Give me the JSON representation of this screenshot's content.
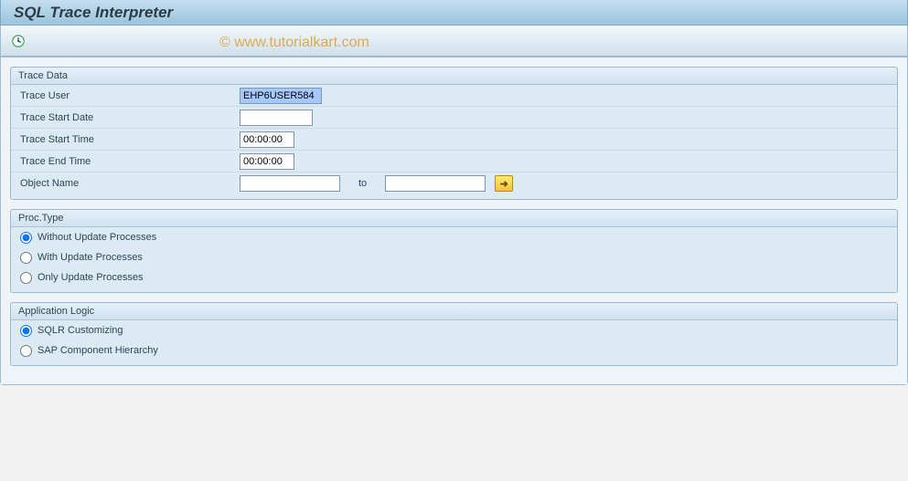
{
  "title": "SQL Trace Interpreter",
  "watermark": "© www.tutorialkart.com",
  "trace": {
    "legend": "Trace Data",
    "user_label": "Trace User",
    "user_value": "EHP6USER584",
    "start_date_label": "Trace Start Date",
    "start_date_value": "",
    "start_time_label": "Trace Start Time",
    "start_time_value": "00:00:00",
    "end_time_label": "Trace End Time",
    "end_time_value": "00:00:00",
    "object_label": "Object Name",
    "object_from": "",
    "object_to_label": "to",
    "object_to": ""
  },
  "proc": {
    "legend": "Proc.Type",
    "opt1": "Without Update Processes",
    "opt2": "With Update Processes",
    "opt3": "Only Update Processes",
    "selected": "opt1"
  },
  "app": {
    "legend": "Application Logic",
    "opt1": "SQLR Customizing",
    "opt2": "SAP Component Hierarchy",
    "selected": "opt1"
  }
}
